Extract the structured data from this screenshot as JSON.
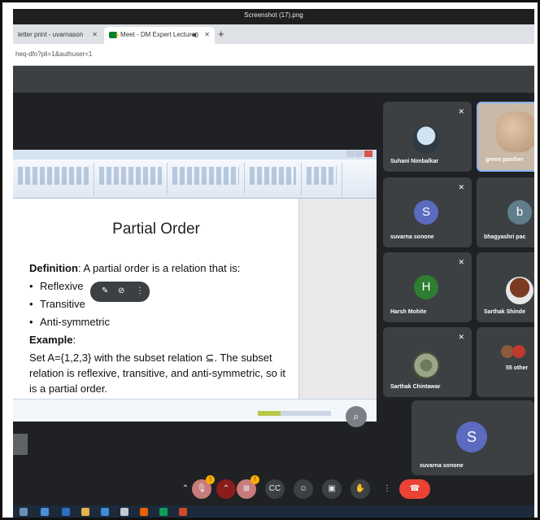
{
  "window": {
    "title": "Screenshot (17).png"
  },
  "browser": {
    "tabs": [
      {
        "label": "letter print - uvarnason",
        "active": false
      },
      {
        "label": "Meet - DM Expert Lecture",
        "active": true
      }
    ],
    "new_tab": "+",
    "url": "heq-dfo?pli=1&authuser=1"
  },
  "slide": {
    "title": "Partial Order",
    "definition_label": "Definition",
    "definition_text": ": A partial order is a relation that is:",
    "bullets": [
      "Reflexive",
      "Transitive",
      "Anti-symmetric"
    ],
    "example_label": "Example",
    "example_colon": ":",
    "example_text": "Set A={1,2,3} with the subset relation ⊆. The subset relation is reflexive, transitive, and anti-symmetric, so it is a partial order."
  },
  "participants": [
    {
      "name": "Suhani Nimbalkar",
      "avatar": "photo",
      "muted": true
    },
    {
      "name": "green panther",
      "avatar": "video",
      "muted": false
    },
    {
      "name": "suvarna sonone",
      "initial": "S",
      "color": "#5c6bc0",
      "muted": true
    },
    {
      "name": "bhagyashri pac",
      "initial": "b",
      "color": "#607d8b",
      "muted": false
    },
    {
      "name": "Harsh Mohite",
      "initial": "H",
      "color": "#2e7d32",
      "muted": true
    },
    {
      "name": "Sarthak Shinde",
      "avatar": "photo",
      "muted": false
    },
    {
      "name": "Sarthak Chintawar",
      "avatar": "photo",
      "muted": true
    },
    {
      "name": "55 other",
      "avatar": "group",
      "muted": false
    }
  ],
  "self_tile": {
    "name": "suvarna sonone",
    "initial": "S",
    "color": "#5c6bc0"
  },
  "controls": {
    "mic_badge": "!",
    "cam_badge": "!",
    "icons": [
      "chevron-up-icon",
      "mic-icon",
      "chevron-up-icon",
      "camera-off-icon",
      "captions-icon",
      "emoji-icon",
      "present-icon",
      "raise-hand-icon",
      "more-icon",
      "leave-call-icon"
    ]
  },
  "colors": {
    "leave": "#ea4335",
    "badge": "#f9ab00",
    "tile_bg": "#3c4043",
    "meet_bg": "#202124"
  }
}
